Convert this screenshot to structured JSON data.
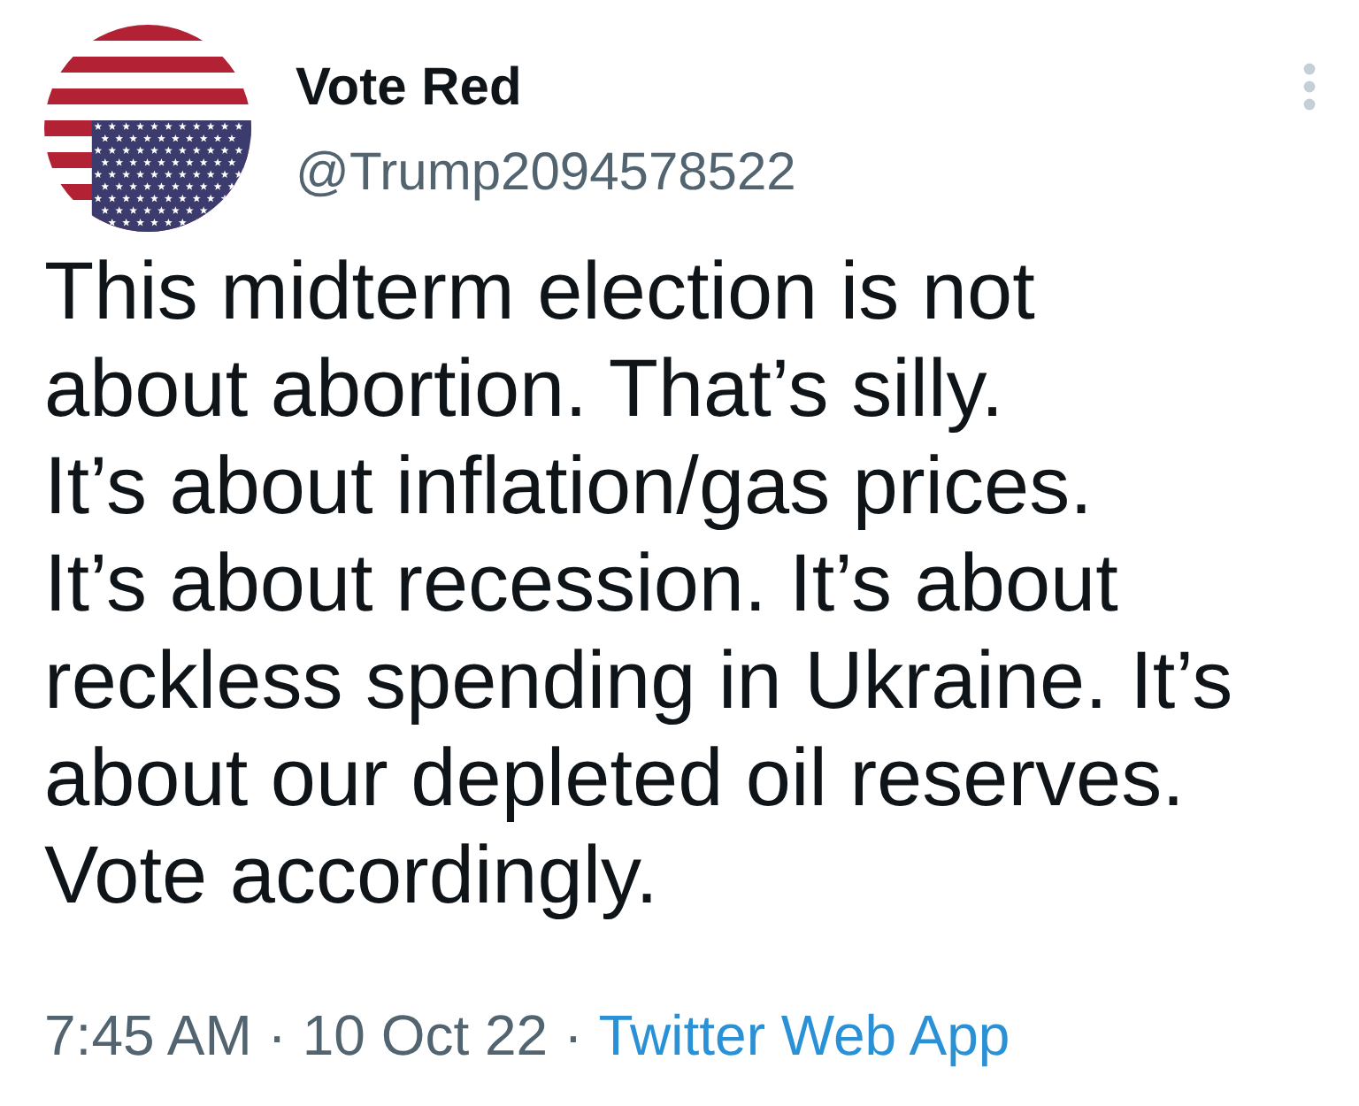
{
  "tweet": {
    "author": {
      "name": "Vote Red",
      "handle": "@Trump2094578522"
    },
    "text": "This midterm election is not about abortion. That’s silly.\nIt’s about inflation/gas prices.\nIt’s about recession. It’s about reckless spending in Ukraine. It’s about our depleted oil reserves.\nVote accordingly.",
    "meta": {
      "timestamp": "7:45 AM · 10 Oct 22",
      "separator": "·",
      "source": "Twitter Web App"
    }
  }
}
